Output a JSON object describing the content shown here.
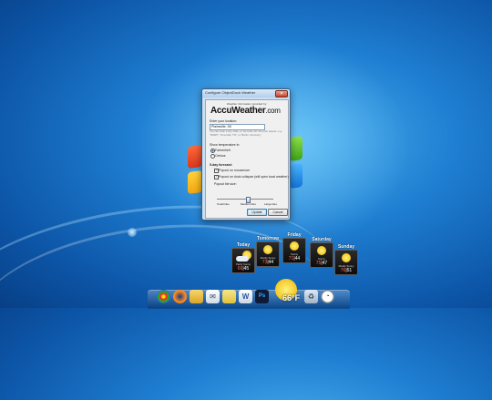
{
  "dialog": {
    "title": "Configure ObjectDock Weather",
    "close_glyph": "✕",
    "provided_by": "Weather information provided by:",
    "logo_main": "AccuWeather",
    "logo_suffix": ".com",
    "location_label": "Enter your location:",
    "location_value": "Plainsville, SK",
    "location_hint": "You can enter a city, state, or zip code. Do not enter spaces. e.g. \"60605\", \"Knoxville, TN\", or \"Berlin, Germany\"",
    "temp_label": "Show temperature in:",
    "unit_fahrenheit": "Fahrenheit",
    "unit_celsius": "Celsius",
    "forecast_label": "5-day forecast:",
    "check_onmouseover": "Popout on mouseover",
    "check_always": "Popout on dock collapse (will open local weather)",
    "popout_size_label": "Popout tile size:",
    "size_small": "Small tiles",
    "size_medium": "Medium tiles",
    "size_large": "Large tiles",
    "update_label": "Update",
    "cancel_label": "Cancel"
  },
  "forecast": [
    {
      "day": "Today",
      "condition": "Partly Sunny",
      "hi": "66",
      "lo": "45",
      "icon": "partly-sunny-icon"
    },
    {
      "day": "Tomorrow",
      "condition": "Mostly Sunny",
      "hi": "73",
      "lo": "44",
      "icon": "sun-icon"
    },
    {
      "day": "Friday",
      "condition": "Sunny",
      "hi": "71",
      "lo": "44",
      "icon": "sun-icon"
    },
    {
      "day": "Saturday",
      "condition": "Sunny",
      "hi": "75",
      "lo": "47",
      "icon": "sun-icon"
    },
    {
      "day": "Sunday",
      "condition": "Mostly Sunny",
      "hi": "76",
      "lo": "51",
      "icon": "sun-icon"
    }
  ],
  "dock": {
    "current_temp": "66°F",
    "icons": [
      "chrome-icon",
      "firefox-icon",
      "folder-icon",
      "mail-icon",
      "notes-icon",
      "word-icon",
      "photoshop-icon",
      "weather-icon",
      "recycle-bin-icon",
      "clock-icon"
    ],
    "photoshop_label": "Ps",
    "colors": {
      "accent": "#1a5fb4",
      "high_temp": "#ff6a4a"
    }
  }
}
